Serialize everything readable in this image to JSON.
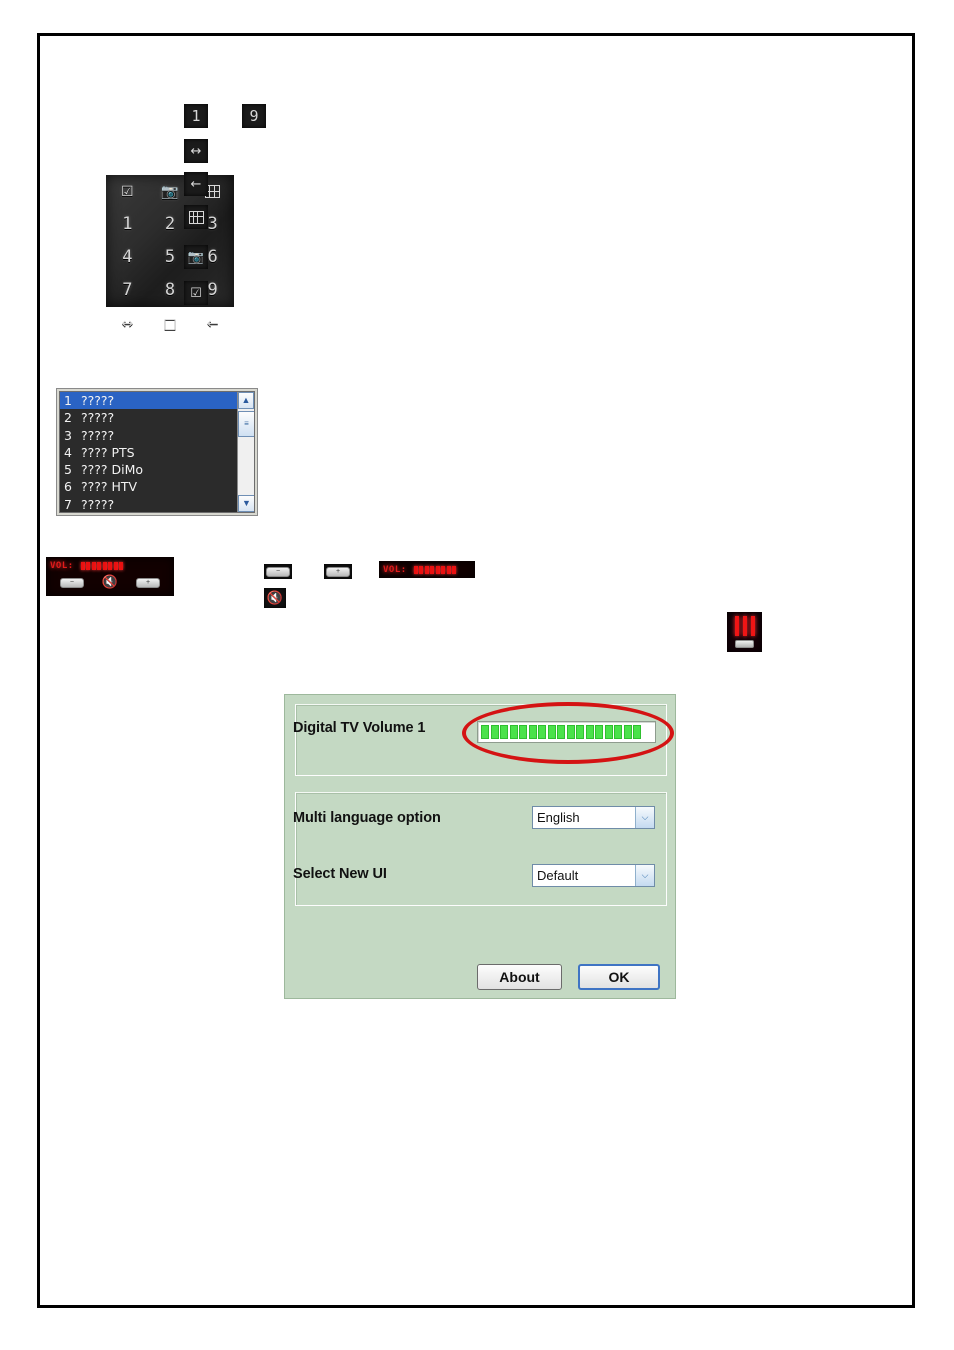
{
  "keypad": {
    "name": "remote-keypad",
    "rows": [
      [
        "☑",
        "📷",
        "grid"
      ],
      [
        "1",
        "2",
        "3"
      ],
      [
        "4",
        "5",
        "6"
      ],
      [
        "7",
        "8",
        "9"
      ],
      [
        "↔",
        "□",
        "←"
      ]
    ]
  },
  "icon_strip": [
    {
      "id": "digit-1-icon",
      "glyph": "1"
    },
    {
      "id": "digit-9-icon",
      "glyph": "9"
    },
    {
      "id": "swap-arrows-icon",
      "glyph": "↔"
    },
    {
      "id": "back-arrow-icon",
      "glyph": "←"
    },
    {
      "id": "epg-grid-icon",
      "glyph": "grid"
    },
    {
      "id": "camera-snapshot-icon",
      "glyph": "📷"
    },
    {
      "id": "checkbox-icon",
      "glyph": "☑"
    }
  ],
  "channel_list": {
    "name": "channel-list",
    "items": [
      {
        "number": "1",
        "label": "?????"
      },
      {
        "number": "2",
        "label": "?????"
      },
      {
        "number": "3",
        "label": "?????"
      },
      {
        "number": "4",
        "label": "???? PTS"
      },
      {
        "number": "5",
        "label": "???? DiMo"
      },
      {
        "number": "6",
        "label": "???? HTV"
      },
      {
        "number": "7",
        "label": "?????"
      }
    ],
    "selected_index": 0,
    "scrollbar": {
      "up": "▲",
      "down": "▼",
      "thumb": "≡"
    }
  },
  "osd": {
    "label": "VOL:",
    "segment_count": 8,
    "vol_down": "−",
    "vol_up": "+",
    "mute": "🔇"
  },
  "osd_small": {
    "label": "VOL:",
    "segment_count": 8
  },
  "small_buttons": {
    "vol_down": "−",
    "vol_up": "+",
    "mute": "🔇"
  },
  "eq_icon": {
    "name": "equalizer-icon"
  },
  "dialog": {
    "volume_label": "Digital TV Volume 1",
    "volume_segments_filled": 17,
    "volume_segments_total": 19,
    "language_label": "Multi language option",
    "language_value": "English",
    "ui_label": "Select New UI",
    "ui_value": "Default",
    "about_button": "About",
    "ok_button": "OK",
    "chevron": "⌵",
    "bg_color": "#c4d9c3",
    "bar_fill_color": "#4ae24a",
    "highlight_color": "#d41313"
  }
}
